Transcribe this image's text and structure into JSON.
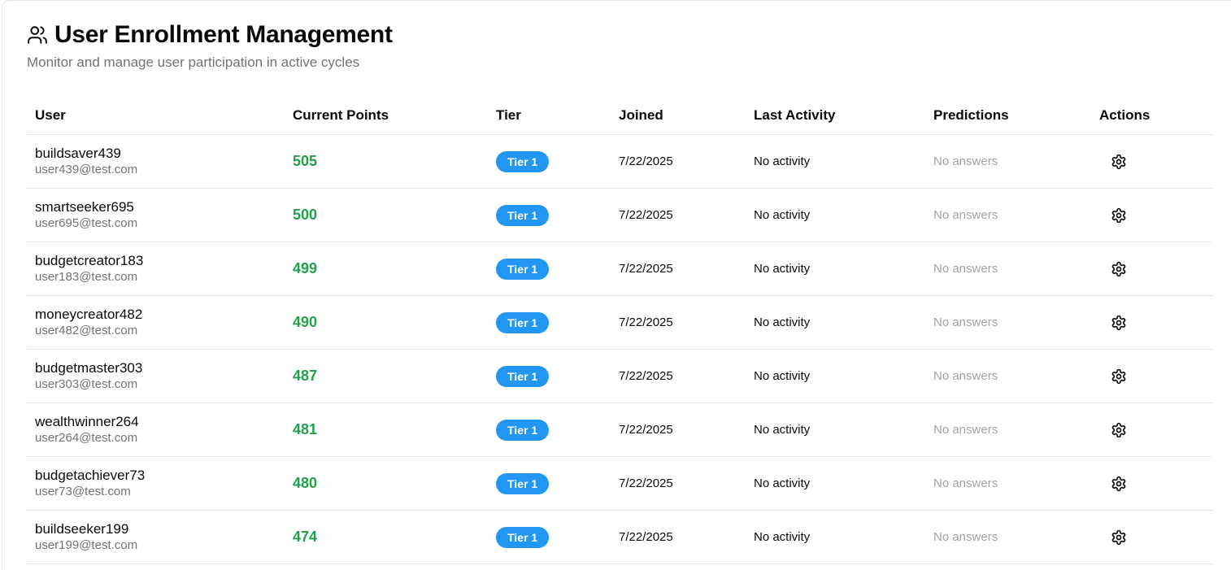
{
  "header": {
    "title": "User Enrollment Management",
    "subtitle": "Monitor and manage user participation in active cycles",
    "icon": "users-icon"
  },
  "table": {
    "columns": [
      "User",
      "Current Points",
      "Tier",
      "Joined",
      "Last Activity",
      "Predictions",
      "Actions"
    ],
    "rows": [
      {
        "username": "buildsaver439",
        "email": "user439@test.com",
        "points": "505",
        "tier": "Tier 1",
        "joined": "7/22/2025",
        "last_activity": "No activity",
        "predictions": "No answers"
      },
      {
        "username": "smartseeker695",
        "email": "user695@test.com",
        "points": "500",
        "tier": "Tier 1",
        "joined": "7/22/2025",
        "last_activity": "No activity",
        "predictions": "No answers"
      },
      {
        "username": "budgetcreator183",
        "email": "user183@test.com",
        "points": "499",
        "tier": "Tier 1",
        "joined": "7/22/2025",
        "last_activity": "No activity",
        "predictions": "No answers"
      },
      {
        "username": "moneycreator482",
        "email": "user482@test.com",
        "points": "490",
        "tier": "Tier 1",
        "joined": "7/22/2025",
        "last_activity": "No activity",
        "predictions": "No answers"
      },
      {
        "username": "budgetmaster303",
        "email": "user303@test.com",
        "points": "487",
        "tier": "Tier 1",
        "joined": "7/22/2025",
        "last_activity": "No activity",
        "predictions": "No answers"
      },
      {
        "username": "wealthwinner264",
        "email": "user264@test.com",
        "points": "481",
        "tier": "Tier 1",
        "joined": "7/22/2025",
        "last_activity": "No activity",
        "predictions": "No answers"
      },
      {
        "username": "budgetachiever73",
        "email": "user73@test.com",
        "points": "480",
        "tier": "Tier 1",
        "joined": "7/22/2025",
        "last_activity": "No activity",
        "predictions": "No answers"
      },
      {
        "username": "buildseeker199",
        "email": "user199@test.com",
        "points": "474",
        "tier": "Tier 1",
        "joined": "7/22/2025",
        "last_activity": "No activity",
        "predictions": "No answers"
      }
    ]
  },
  "colors": {
    "points": "#22a04b",
    "tier_badge": "#2196f3",
    "muted": "#737373"
  },
  "icons": {
    "action": "gear-icon"
  }
}
